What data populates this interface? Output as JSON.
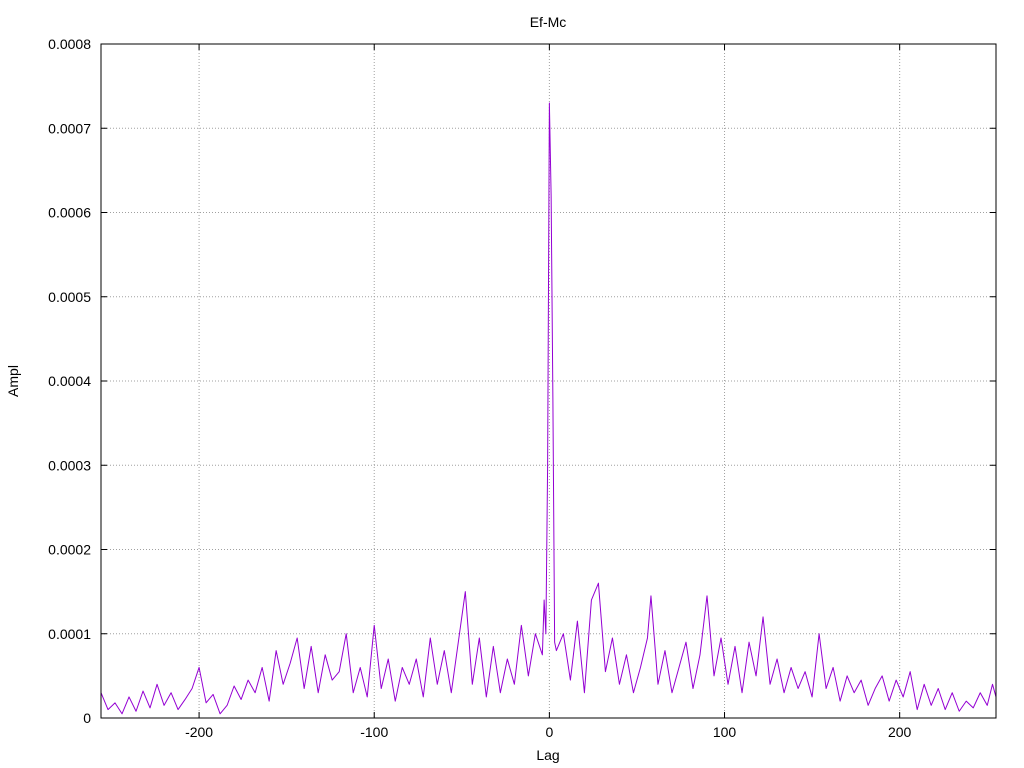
{
  "chart_data": {
    "type": "line",
    "title": "Ef-Mc",
    "xlabel": "Lag",
    "ylabel": "Ampl",
    "xlim": [
      -256,
      255
    ],
    "ylim": [
      0,
      0.0008
    ],
    "x_ticks": [
      -200,
      -100,
      0,
      100,
      200
    ],
    "x_tick_labels": [
      "-200",
      "-100",
      "0",
      "100",
      "200"
    ],
    "y_ticks": [
      0,
      0.0001,
      0.0002,
      0.0003,
      0.0004,
      0.0005,
      0.0006,
      0.0007,
      0.0008
    ],
    "y_tick_labels": [
      "0",
      "0.0001",
      "0.0002",
      "0.0003",
      "0.0004",
      "0.0005",
      "0.0006",
      "0.0007",
      "0.0008"
    ],
    "grid": true,
    "series": [
      {
        "color": "#9400d3",
        "points": [
          [
            -256,
            3e-05
          ],
          [
            -252,
            1e-05
          ],
          [
            -248,
            1.8e-05
          ],
          [
            -244,
            5e-06
          ],
          [
            -240,
            2.5e-05
          ],
          [
            -236,
            8e-06
          ],
          [
            -232,
            3.2e-05
          ],
          [
            -228,
            1.2e-05
          ],
          [
            -224,
            4e-05
          ],
          [
            -220,
            1.5e-05
          ],
          [
            -216,
            3e-05
          ],
          [
            -212,
            1e-05
          ],
          [
            -208,
            2.2e-05
          ],
          [
            -204,
            3.5e-05
          ],
          [
            -200,
            6e-05
          ],
          [
            -196,
            1.8e-05
          ],
          [
            -192,
            2.8e-05
          ],
          [
            -188,
            5e-06
          ],
          [
            -184,
            1.5e-05
          ],
          [
            -180,
            3.8e-05
          ],
          [
            -176,
            2.2e-05
          ],
          [
            -172,
            4.5e-05
          ],
          [
            -168,
            3e-05
          ],
          [
            -164,
            6e-05
          ],
          [
            -160,
            2e-05
          ],
          [
            -156,
            8e-05
          ],
          [
            -152,
            4e-05
          ],
          [
            -148,
            6.5e-05
          ],
          [
            -144,
            9.5e-05
          ],
          [
            -140,
            3.5e-05
          ],
          [
            -136,
            8.5e-05
          ],
          [
            -132,
            3e-05
          ],
          [
            -128,
            7.5e-05
          ],
          [
            -124,
            4.5e-05
          ],
          [
            -120,
            5.5e-05
          ],
          [
            -116,
            0.0001
          ],
          [
            -112,
            3e-05
          ],
          [
            -108,
            6e-05
          ],
          [
            -104,
            2.5e-05
          ],
          [
            -100,
            0.00011
          ],
          [
            -96,
            3.5e-05
          ],
          [
            -92,
            7e-05
          ],
          [
            -88,
            2e-05
          ],
          [
            -84,
            6e-05
          ],
          [
            -80,
            4e-05
          ],
          [
            -76,
            7e-05
          ],
          [
            -72,
            2.5e-05
          ],
          [
            -68,
            9.5e-05
          ],
          [
            -64,
            4e-05
          ],
          [
            -60,
            8e-05
          ],
          [
            -56,
            3e-05
          ],
          [
            -52,
            9e-05
          ],
          [
            -48,
            0.00015
          ],
          [
            -44,
            4e-05
          ],
          [
            -40,
            9.5e-05
          ],
          [
            -36,
            2.5e-05
          ],
          [
            -32,
            8.5e-05
          ],
          [
            -28,
            3e-05
          ],
          [
            -24,
            7e-05
          ],
          [
            -20,
            4e-05
          ],
          [
            -16,
            0.00011
          ],
          [
            -12,
            5e-05
          ],
          [
            -8,
            0.0001
          ],
          [
            -4,
            7.5e-05
          ],
          [
            -3,
            0.00014
          ],
          [
            -2,
            0.0001
          ],
          [
            -1,
            0.0003
          ],
          [
            0,
            0.00073
          ],
          [
            1,
            0.00062
          ],
          [
            2,
            0.00038
          ],
          [
            3,
            9e-05
          ],
          [
            4,
            8e-05
          ],
          [
            8,
            0.0001
          ],
          [
            12,
            4.5e-05
          ],
          [
            16,
            0.000115
          ],
          [
            20,
            3e-05
          ],
          [
            24,
            0.00014
          ],
          [
            28,
            0.00016
          ],
          [
            32,
            5.5e-05
          ],
          [
            36,
            9.5e-05
          ],
          [
            40,
            4e-05
          ],
          [
            44,
            7.5e-05
          ],
          [
            48,
            3e-05
          ],
          [
            52,
            6e-05
          ],
          [
            56,
            9.5e-05
          ],
          [
            58,
            0.000145
          ],
          [
            62,
            4e-05
          ],
          [
            66,
            8e-05
          ],
          [
            70,
            3e-05
          ],
          [
            74,
            6e-05
          ],
          [
            78,
            9e-05
          ],
          [
            82,
            3.5e-05
          ],
          [
            86,
            7.5e-05
          ],
          [
            90,
            0.000145
          ],
          [
            94,
            5e-05
          ],
          [
            98,
            9.5e-05
          ],
          [
            102,
            4e-05
          ],
          [
            106,
            8.5e-05
          ],
          [
            110,
            3e-05
          ],
          [
            114,
            9e-05
          ],
          [
            118,
            5e-05
          ],
          [
            122,
            0.00012
          ],
          [
            126,
            4e-05
          ],
          [
            130,
            7e-05
          ],
          [
            134,
            3e-05
          ],
          [
            138,
            6e-05
          ],
          [
            142,
            3.5e-05
          ],
          [
            146,
            5.5e-05
          ],
          [
            150,
            2.5e-05
          ],
          [
            154,
            0.0001
          ],
          [
            158,
            3.5e-05
          ],
          [
            162,
            6e-05
          ],
          [
            166,
            2e-05
          ],
          [
            170,
            5e-05
          ],
          [
            174,
            3e-05
          ],
          [
            178,
            4.5e-05
          ],
          [
            182,
            1.5e-05
          ],
          [
            186,
            3.5e-05
          ],
          [
            190,
            5e-05
          ],
          [
            194,
            2e-05
          ],
          [
            198,
            4.5e-05
          ],
          [
            202,
            2.5e-05
          ],
          [
            206,
            5.5e-05
          ],
          [
            210,
            1e-05
          ],
          [
            214,
            4e-05
          ],
          [
            218,
            1.5e-05
          ],
          [
            222,
            3.5e-05
          ],
          [
            226,
            1e-05
          ],
          [
            230,
            3e-05
          ],
          [
            234,
            8e-06
          ],
          [
            238,
            2e-05
          ],
          [
            242,
            1.2e-05
          ],
          [
            246,
            3e-05
          ],
          [
            250,
            1.5e-05
          ],
          [
            253,
            4e-05
          ],
          [
            255,
            2.5e-05
          ]
        ]
      }
    ]
  }
}
